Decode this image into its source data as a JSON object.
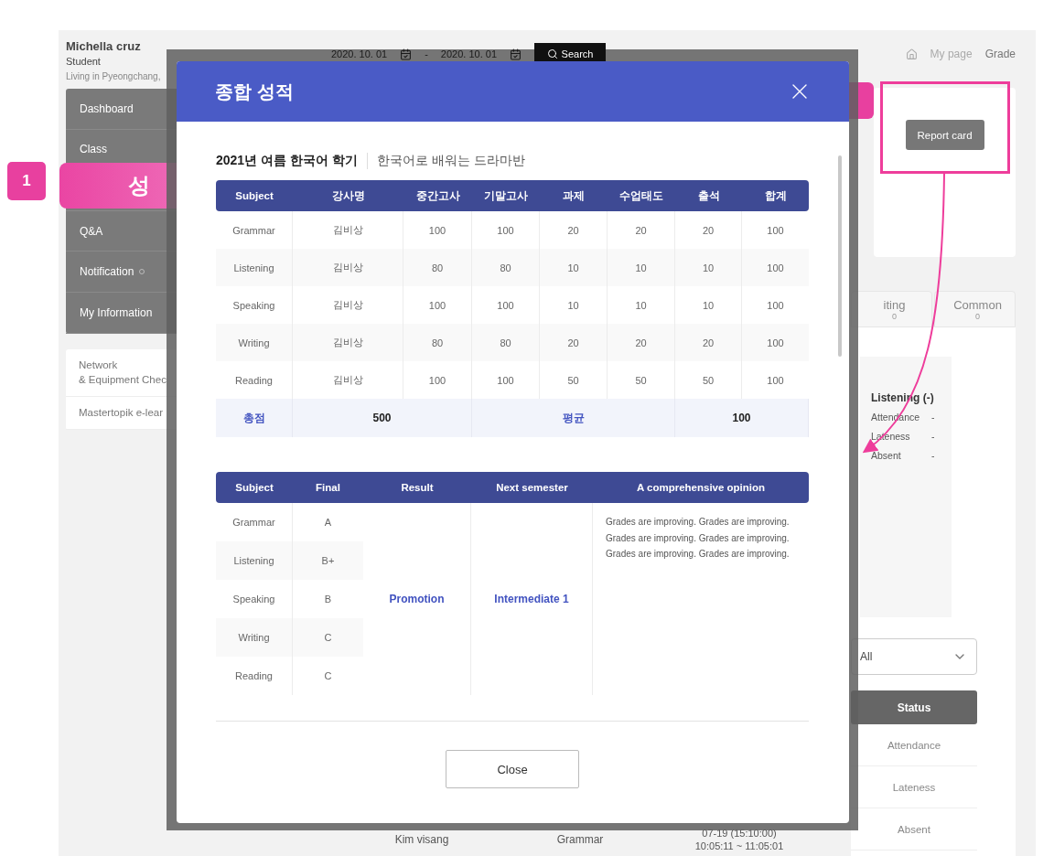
{
  "annotations": {
    "badge": "1",
    "banner": "성"
  },
  "sidebar": {
    "name": "Michella cruz",
    "role": "Student",
    "location": "Living in Pyeongchang,",
    "menu": [
      {
        "kind": "item",
        "label": "Dashboard",
        "indicator": false
      },
      {
        "kind": "item",
        "label": "Class",
        "indicator": false
      },
      {
        "kind": "covered"
      },
      {
        "kind": "item",
        "label": "Q&A",
        "indicator": false
      },
      {
        "kind": "item",
        "label": "Notification",
        "indicator": true
      },
      {
        "kind": "item",
        "label": "My Information",
        "indicator": false
      }
    ],
    "links": [
      "Network\n& Equipment Chec",
      "Mastertopik e-lear"
    ]
  },
  "filters": {
    "date_from": "2020. 10. 01",
    "separator": "-",
    "date_to": "2020. 10. 01",
    "search": "Search"
  },
  "breadcrumb": [
    "My page",
    "Grade"
  ],
  "report_card_button": "Report card",
  "tabs": [
    {
      "label": "iting",
      "count": "0"
    },
    {
      "label": "Common",
      "count": "0"
    }
  ],
  "summary": {
    "title": "Listening (-)",
    "rows": [
      {
        "label": "Attendance",
        "value": "-"
      },
      {
        "label": "Lateness",
        "value": "-"
      },
      {
        "label": "Absent",
        "value": "-"
      }
    ]
  },
  "status_filter": "All",
  "status_table": {
    "header": "Status",
    "rows": [
      "Attendance",
      "Lateness",
      "Absent"
    ]
  },
  "bottom_row": {
    "student": "Kim visang",
    "subject": "Grammar",
    "date": "07-19 (15:10:00)",
    "time": "10:05:11 ~ 11:05:01"
  },
  "modal": {
    "title": "종합 성적",
    "term": "2021년 여름 한국어 학기",
    "course": "한국어로 배워는 드라마반",
    "score_table": {
      "columns": [
        "Subject",
        "강사명",
        "중간고사",
        "기말고사",
        "과제",
        "수업태도",
        "출석",
        "합계"
      ],
      "rows": [
        [
          "Grammar",
          "김비상",
          "100",
          "100",
          "20",
          "20",
          "20",
          "100"
        ],
        [
          "Listening",
          "김비상",
          "80",
          "80",
          "10",
          "10",
          "10",
          "100"
        ],
        [
          "Speaking",
          "김비상",
          "100",
          "100",
          "10",
          "10",
          "10",
          "100"
        ],
        [
          "Writing",
          "김비상",
          "80",
          "80",
          "20",
          "20",
          "20",
          "100"
        ],
        [
          "Reading",
          "김비상",
          "100",
          "100",
          "50",
          "50",
          "50",
          "100"
        ]
      ],
      "total": {
        "label": "총점",
        "sum": "500",
        "avg_label": "평균",
        "avg": "100"
      }
    },
    "result_table": {
      "columns": [
        "Subject",
        "Final",
        "Result",
        "Next semester",
        "A comprehensive opinion"
      ],
      "rows": [
        {
          "subject": "Grammar",
          "final": "A"
        },
        {
          "subject": "Listening",
          "final": "B+"
        },
        {
          "subject": "Speaking",
          "final": "B"
        },
        {
          "subject": "Writing",
          "final": "C"
        },
        {
          "subject": "Reading",
          "final": "C"
        }
      ],
      "result": "Promotion",
      "next": "Intermediate 1",
      "opinion": "Grades are improving. Grades are improving. Grades are improving. Grades are improving. Grades are improving. Grades are improving."
    },
    "close": "Close"
  }
}
